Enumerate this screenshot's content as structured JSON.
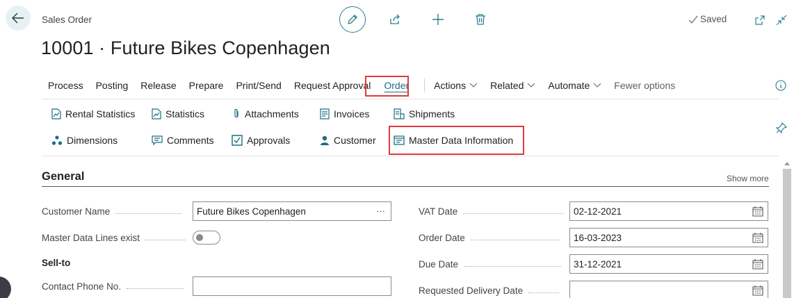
{
  "page": {
    "caption": "Sales Order",
    "title": "10001 · Future Bikes Copenhagen",
    "saved_label": "Saved"
  },
  "menu": {
    "items": [
      {
        "label": "Process"
      },
      {
        "label": "Posting"
      },
      {
        "label": "Release"
      },
      {
        "label": "Prepare"
      },
      {
        "label": "Print/Send"
      },
      {
        "label": "Request Approval"
      },
      {
        "label": "Order"
      },
      {
        "label": "Actions"
      },
      {
        "label": "Related"
      },
      {
        "label": "Automate"
      },
      {
        "label": "Fewer options"
      }
    ]
  },
  "ribbon": {
    "rental_statistics": "Rental Statistics",
    "statistics": "Statistics",
    "attachments": "Attachments",
    "invoices": "Invoices",
    "shipments": "Shipments",
    "dimensions": "Dimensions",
    "comments": "Comments",
    "approvals": "Approvals",
    "customer": "Customer",
    "master_data": "Master Data Information"
  },
  "general": {
    "title": "General",
    "show_more": "Show more",
    "customer_name": {
      "label": "Customer Name",
      "value": "Future Bikes Copenhagen",
      "more": "···"
    },
    "master_data_lines": {
      "label": "Master Data Lines exist",
      "value": false
    },
    "sell_to": "Sell-to",
    "contact_phone": {
      "label": "Contact Phone No.",
      "value": ""
    },
    "vat_date": {
      "label": "VAT Date",
      "value": "02-12-2021"
    },
    "order_date": {
      "label": "Order Date",
      "value": "16-03-2023"
    },
    "due_date": {
      "label": "Due Date",
      "value": "31-12-2021"
    },
    "requested_delivery": {
      "label": "Requested Delivery Date",
      "value": ""
    }
  },
  "colors": {
    "accent": "#1a6e80",
    "highlight": "#e0393e"
  }
}
